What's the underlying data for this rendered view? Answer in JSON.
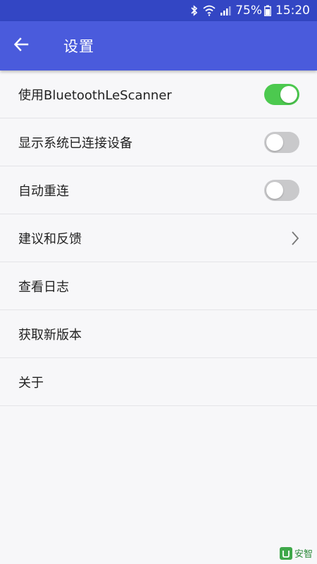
{
  "status_bar": {
    "battery_percent": "75%",
    "time": "15:20",
    "icons": [
      "bluetooth-icon",
      "wifi-icon",
      "cellular-signal-icon",
      "battery-icon"
    ]
  },
  "app_bar": {
    "back_icon": "arrow-left-icon",
    "title": "设置"
  },
  "settings": [
    {
      "label": "使用BluetoothLeScanner",
      "control": "switch",
      "checked": true
    },
    {
      "label": "显示系统已连接设备",
      "control": "switch",
      "checked": false
    },
    {
      "label": "自动重连",
      "control": "switch",
      "checked": false
    },
    {
      "label": "建议和反馈",
      "control": "chevron"
    },
    {
      "label": "查看日志",
      "control": "none"
    },
    {
      "label": "获取新版本",
      "control": "none"
    },
    {
      "label": "关于",
      "control": "none"
    }
  ],
  "colors": {
    "status_bar": "#3346c4",
    "app_bar": "#4a5bdc",
    "switch_on": "#4cc94f",
    "switch_off": "#c9c9cb",
    "background": "#f7f7f9"
  },
  "watermark": {
    "text": "安智"
  }
}
